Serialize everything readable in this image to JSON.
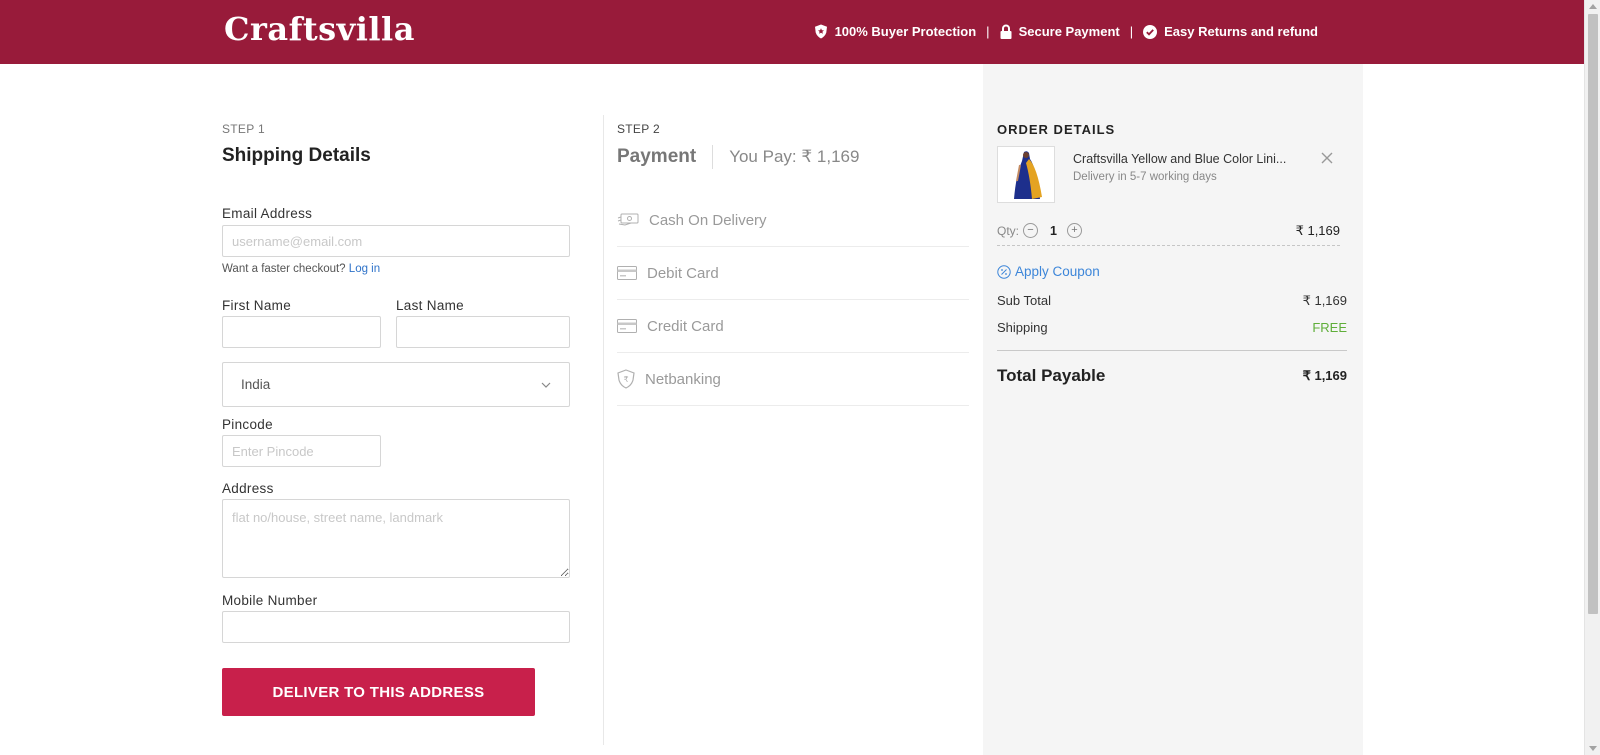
{
  "header": {
    "brand": "Craftsvilla",
    "trust": [
      {
        "label": "100% Buyer Protection",
        "icon": "shield-icon"
      },
      {
        "label": "Secure Payment",
        "icon": "lock-icon"
      },
      {
        "label": "Easy Returns and refund",
        "icon": "check-circle-icon"
      }
    ],
    "separator": "|",
    "bg_color": "#981b3a"
  },
  "shipping": {
    "step": "STEP 1",
    "title": "Shipping Details",
    "email_label": "Email Address",
    "email_placeholder": "username@email.com",
    "email_value": "",
    "faster_checkout": "Want a faster checkout?",
    "login_link": "Log in",
    "first_name_label": "First Name",
    "last_name_label": "Last Name",
    "country": "India",
    "pincode_label": "Pincode",
    "pincode_placeholder": "Enter Pincode",
    "address_label": "Address",
    "address_placeholder": "flat no/house, street name, landmark",
    "mobile_label": "Mobile Number",
    "deliver_button": "DELIVER TO THIS ADDRESS",
    "button_color": "#c8204b"
  },
  "payment": {
    "step": "STEP 2",
    "title": "Payment",
    "you_pay": "You Pay: ₹ 1,169",
    "methods": [
      {
        "label": "Cash On Delivery",
        "icon": "cash-icon"
      },
      {
        "label": "Debit Card",
        "icon": "card-icon"
      },
      {
        "label": "Credit Card",
        "icon": "card-icon"
      },
      {
        "label": "Netbanking",
        "icon": "rupee-shield-icon"
      }
    ]
  },
  "order": {
    "title": "ORDER DETAILS",
    "product_name": "Craftsvilla Yellow and Blue Color Lini...",
    "delivery": "Delivery in 5-7 working days",
    "qty_label": "Qty:",
    "qty": "1",
    "item_price": "₹ 1,169",
    "apply_coupon": "Apply Coupon",
    "sub_total_label": "Sub Total",
    "sub_total": "₹ 1,169",
    "shipping_label": "Shipping",
    "shipping_value": "FREE",
    "total_label": "Total Payable",
    "total_value": "₹ 1,169"
  }
}
